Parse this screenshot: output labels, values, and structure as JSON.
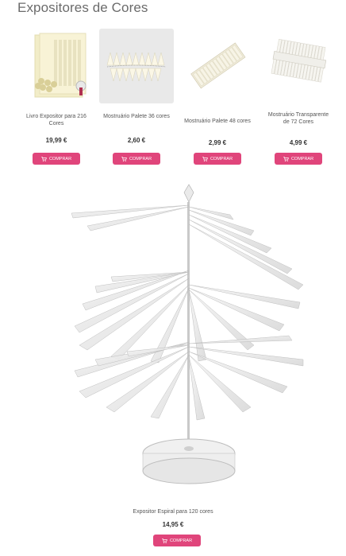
{
  "page": {
    "title": "Expositores de Cores"
  },
  "products": [
    {
      "name": "Livro Expositor para 216 Cores",
      "price": "19,99 €",
      "button": "COMPRAR",
      "icon": "cart-icon"
    },
    {
      "name": "Mostruário Palete 36 cores",
      "price": "2,60 €",
      "button": "COMPRAR",
      "icon": "cart-icon"
    },
    {
      "name": "Mostruário Palete 48 cores",
      "price": "2,99 €",
      "button": "COMPRAR",
      "icon": "cart-icon"
    },
    {
      "name": "Mostruário Transparente de 72 Cores",
      "price": "4,99 €",
      "button": "COMPRAR",
      "icon": "cart-icon"
    }
  ],
  "featured": {
    "name": "Expositor Espiral para 120 cores",
    "price": "14,95 €",
    "button": "COMPRAR",
    "icon": "cart-icon"
  },
  "colors": {
    "accent": "#e0457b",
    "title": "#6b6b6b"
  }
}
